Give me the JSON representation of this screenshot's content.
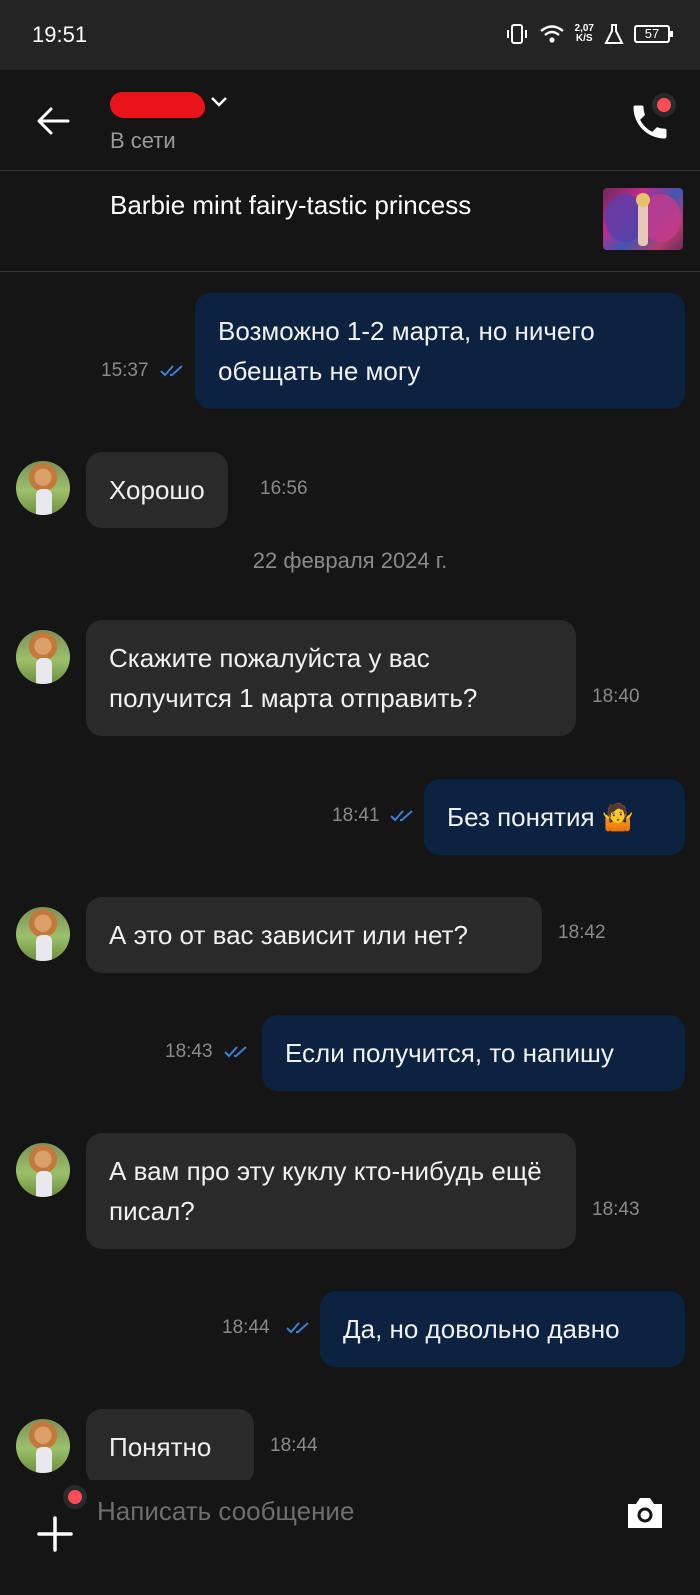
{
  "status_bar": {
    "time": "19:51",
    "net_speed_value": "2,07",
    "net_speed_unit": "K/S",
    "battery": "57"
  },
  "header": {
    "status": "В сети"
  },
  "product": {
    "title": "Barbie mint fairy-tastic princess"
  },
  "messages": [
    {
      "dir": "out",
      "text": "Возможно 1-2 марта, но ничего обещать не могу",
      "time": "15:37",
      "read": true
    },
    {
      "dir": "in",
      "text": "Хорошо",
      "time": "16:56"
    },
    {
      "dir": "in",
      "text": "Скажите пожалуйста у вас получится 1 марта отправить?",
      "time": "18:40"
    },
    {
      "dir": "out",
      "text": "Без понятия 🤷",
      "time": "18:41",
      "read": true
    },
    {
      "dir": "in",
      "text": "А это от вас зависит или нет?",
      "time": "18:42"
    },
    {
      "dir": "out",
      "text": "Если получится, то напишу",
      "time": "18:43",
      "read": true
    },
    {
      "dir": "in",
      "text": "А вам про эту куклу кто-нибудь ещё писал?",
      "time": "18:43"
    },
    {
      "dir": "out",
      "text": "Да, но довольно давно",
      "time": "18:44",
      "read": true
    },
    {
      "dir": "in",
      "text": "Понятно",
      "time": "18:44"
    }
  ],
  "date_separator": "22 февраля 2024 г.",
  "composer": {
    "placeholder": "Написать сообщение"
  },
  "colors": {
    "background": "#151515",
    "outgoing_bubble": "#0b2340",
    "incoming_bubble": "#2a2a2a",
    "read_tick": "#3d7fd6",
    "notification_dot": "#ff4d57",
    "redaction": "#e8141a"
  },
  "icons": [
    "back-arrow-icon",
    "chevron-down-icon",
    "phone-icon",
    "double-check-icon",
    "plus-icon",
    "camera-icon",
    "vibrate-icon",
    "wifi-icon",
    "battery-icon"
  ]
}
